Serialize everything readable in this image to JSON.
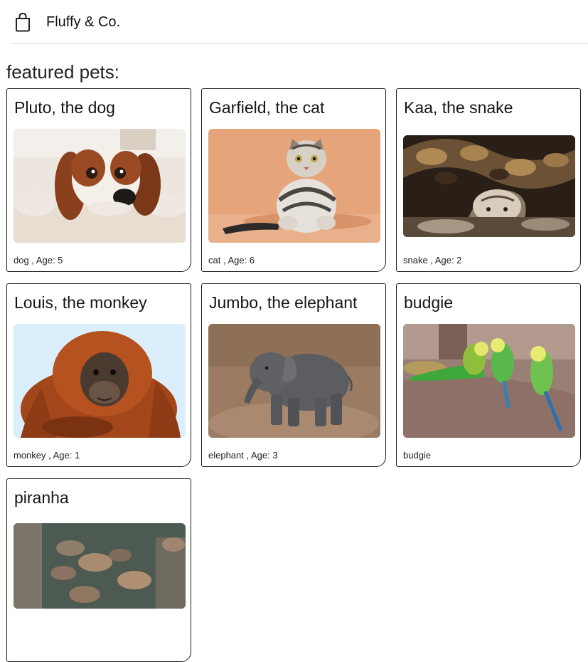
{
  "header": {
    "brand": "Fluffy & Co.",
    "icon": "shopping-bag-icon"
  },
  "heading": "featured pets:",
  "pets": [
    {
      "title": "Pluto, the dog",
      "meta": "dog , Age: 5",
      "image": "dog-photo"
    },
    {
      "title": "Garfield, the cat",
      "meta": "cat , Age: 6",
      "image": "cat-photo"
    },
    {
      "title": "Kaa, the snake",
      "meta": "snake , Age: 2",
      "image": "snake-photo"
    },
    {
      "title": "Louis, the monkey",
      "meta": "monkey , Age: 1",
      "image": "monkey-photo"
    },
    {
      "title": "Jumbo, the elephant",
      "meta": "elephant , Age: 3",
      "image": "elephant-photo"
    },
    {
      "title": "budgie",
      "meta": "budgie",
      "image": "budgie-photo"
    },
    {
      "title": "piranha",
      "meta": "",
      "image": "piranha-photo"
    }
  ]
}
